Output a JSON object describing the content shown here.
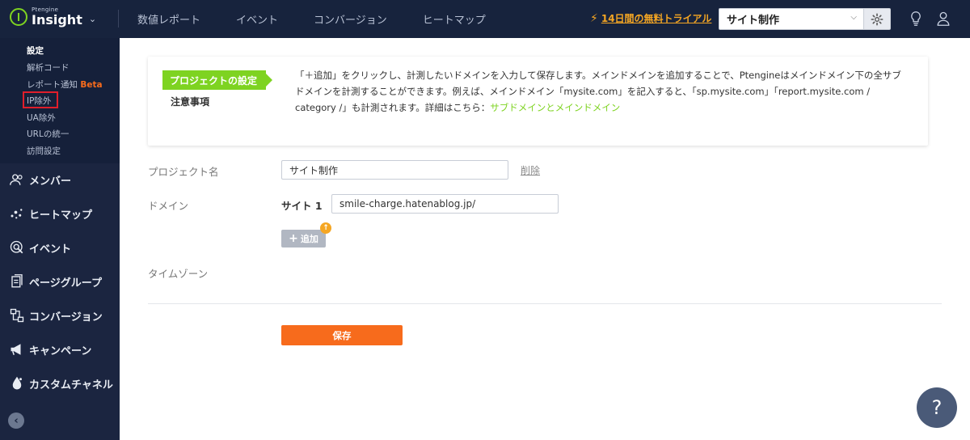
{
  "header": {
    "brand_small": "Ptengine",
    "brand_name": "Insight",
    "nav": [
      "数値レポート",
      "イベント",
      "コンバージョン",
      "ヒートマップ"
    ],
    "trial_label": "14日間の無料トライアル",
    "site_select_value": "サイト制作"
  },
  "sidebar": {
    "sub_items": [
      {
        "label": "設定"
      },
      {
        "label": "解析コード"
      },
      {
        "label": "レポート通知",
        "badge": "Beta"
      },
      {
        "label": "IP除外"
      },
      {
        "label": "UA除外"
      },
      {
        "label": "URLの統一"
      },
      {
        "label": "訪問設定"
      }
    ],
    "main_items": [
      {
        "label": "メンバー",
        "icon": "members-icon"
      },
      {
        "label": "ヒートマップ",
        "icon": "heatmap-icon"
      },
      {
        "label": "イベント",
        "icon": "event-icon"
      },
      {
        "label": "ページグループ",
        "icon": "page-group-icon"
      },
      {
        "label": "コンバージョン",
        "icon": "conversion-icon"
      },
      {
        "label": "キャンペーン",
        "icon": "megaphone-icon"
      },
      {
        "label": "カスタムチャネル",
        "icon": "drop-icon"
      }
    ]
  },
  "notice": {
    "tag": "プロジェクトの設定",
    "sub_tag": "注意事項",
    "text": "「＋追加」をクリックし、計測したいドメインを入力して保存します。メインドメインを追加することで、Ptengineはメインドメイン下の全サブドメインを計測することができます。例えば、メインドメイン「mysite.com」を記入すると、「sp.mysite.com」「report.mysite.com / category /」も計測されます。詳細はこちら：",
    "link": "サブドメインとメインドメイン"
  },
  "form": {
    "project_name_label": "プロジェクト名",
    "project_name_value": "サイト制作",
    "delete_label": "削除",
    "domain_label": "ドメイン",
    "site_label": "サイト 1",
    "site_value": "smile-charge.hatenablog.jp/",
    "add_label": "追加",
    "add_badge": "↑",
    "timezone_label": "タイムゾーン",
    "save_label": "保存"
  },
  "help_label": "?",
  "colors": {
    "topbar": "#17233d",
    "sidebar": "#1b2540",
    "accent_green": "#7ed321",
    "accent_orange": "#f76b1c",
    "trial_orange": "#f5a623"
  }
}
